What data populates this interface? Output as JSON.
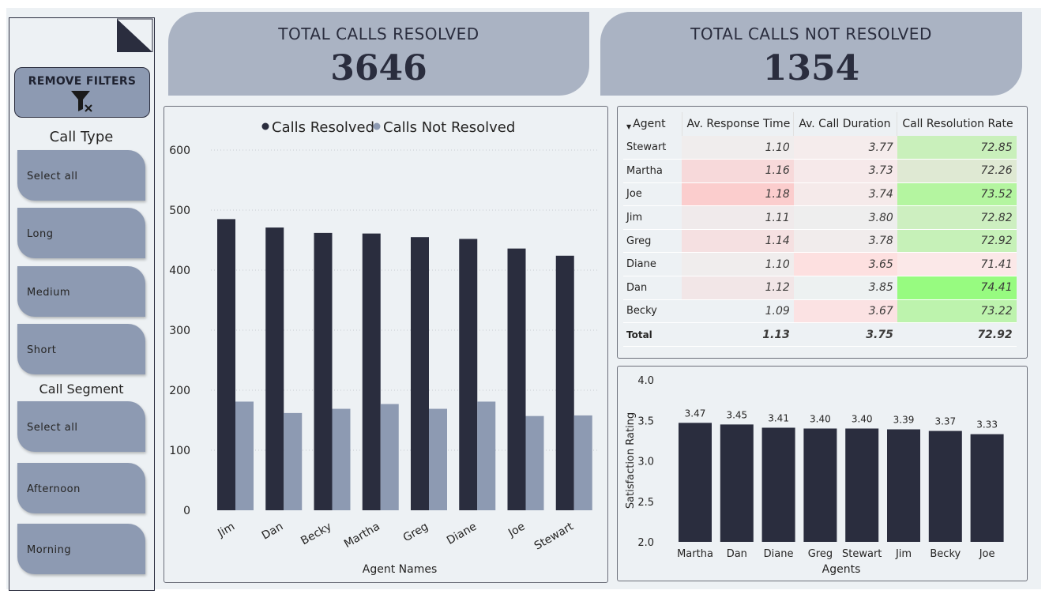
{
  "sidebar": {
    "remove_filters": "REMOVE FILTERS",
    "call_type": {
      "title": "Call Type",
      "options": [
        "Select all",
        "Long",
        "Medium",
        "Short"
      ]
    },
    "call_segment": {
      "title": "Call Segment",
      "options": [
        "Select all",
        "Afternoon",
        "Morning"
      ]
    }
  },
  "kpis": {
    "resolved": {
      "title": "TOTAL CALLS RESOLVED",
      "value": "3646"
    },
    "not_resolved": {
      "title": "TOTAL CALLS NOT RESOLVED",
      "value": "1354"
    }
  },
  "table": {
    "headers": [
      "Agent",
      "Av. Response Time",
      "Av. Call Duration",
      "Call Resolution Rate"
    ],
    "rows": [
      {
        "agent": "Stewart",
        "response": "1.10",
        "duration": "3.77",
        "rate": "72.85",
        "colors": [
          "#f0eded",
          "#f5ecec",
          "#c9f0bb"
        ]
      },
      {
        "agent": "Martha",
        "response": "1.16",
        "duration": "3.73",
        "rate": "72.26",
        "colors": [
          "#f7d9da",
          "#f6e9ea",
          "#dfe9d3"
        ]
      },
      {
        "agent": "Joe",
        "response": "1.18",
        "duration": "3.74",
        "rate": "73.52",
        "colors": [
          "#fbcdcd",
          "#f5eaea",
          "#b4f5a0"
        ]
      },
      {
        "agent": "Jim",
        "response": "1.11",
        "duration": "3.80",
        "rate": "72.82",
        "colors": [
          "#f0eaeb",
          "#eeeeee",
          "#cdefc0"
        ]
      },
      {
        "agent": "Greg",
        "response": "1.14",
        "duration": "3.78",
        "rate": "72.92",
        "colors": [
          "#f5e0e1",
          "#f1ecec",
          "#c6f1b8"
        ]
      },
      {
        "agent": "Diane",
        "response": "1.10",
        "duration": "3.65",
        "rate": "71.41",
        "colors": [
          "#f0eded",
          "#fde0e0",
          "#fbe8e8"
        ]
      },
      {
        "agent": "Dan",
        "response": "1.12",
        "duration": "3.85",
        "rate": "74.41",
        "colors": [
          "#f2e6e7",
          "#edf1f1",
          "#97fb80"
        ]
      },
      {
        "agent": "Becky",
        "response": "1.09",
        "duration": "3.67",
        "rate": "73.22",
        "colors": [
          "#edf1f4",
          "#fbe2e3",
          "#bdf3ad"
        ]
      }
    ],
    "total": {
      "label": "Total",
      "response": "1.13",
      "duration": "3.75",
      "rate": "72.92"
    }
  },
  "chart_data": [
    {
      "type": "bar",
      "title": "",
      "categories": [
        "Jim",
        "Dan",
        "Becky",
        "Martha",
        "Greg",
        "Diane",
        "Joe",
        "Stewart"
      ],
      "series": [
        {
          "name": "Calls Resolved",
          "color": "#2a2d3e",
          "values": [
            485,
            471,
            462,
            461,
            455,
            452,
            436,
            424
          ]
        },
        {
          "name": "Calls Not Resolved",
          "color": "#8d9ab2",
          "values": [
            181,
            162,
            169,
            177,
            169,
            181,
            157,
            158
          ]
        }
      ],
      "xlabel": "Agent Names",
      "ylabel": "",
      "ylim": [
        0,
        600
      ],
      "yticks": [
        0,
        100,
        200,
        300,
        400,
        500,
        600
      ],
      "legend": "top-center",
      "grid": true
    },
    {
      "type": "bar",
      "title": "",
      "categories": [
        "Martha",
        "Dan",
        "Diane",
        "Greg",
        "Stewart",
        "Jim",
        "Becky",
        "Joe"
      ],
      "values": [
        3.47,
        3.45,
        3.41,
        3.4,
        3.4,
        3.39,
        3.37,
        3.33
      ],
      "data_labels": [
        "3.47",
        "3.45",
        "3.41",
        "3.40",
        "3.40",
        "3.39",
        "3.37",
        "3.33"
      ],
      "xlabel": "Agents",
      "ylabel": "Satisfaction Rating",
      "ylim": [
        2.0,
        4.0
      ],
      "yticks": [
        "2.0",
        "2.5",
        "3.0",
        "3.5",
        "4.0"
      ],
      "color": "#2a2d3e",
      "grid": false
    }
  ]
}
